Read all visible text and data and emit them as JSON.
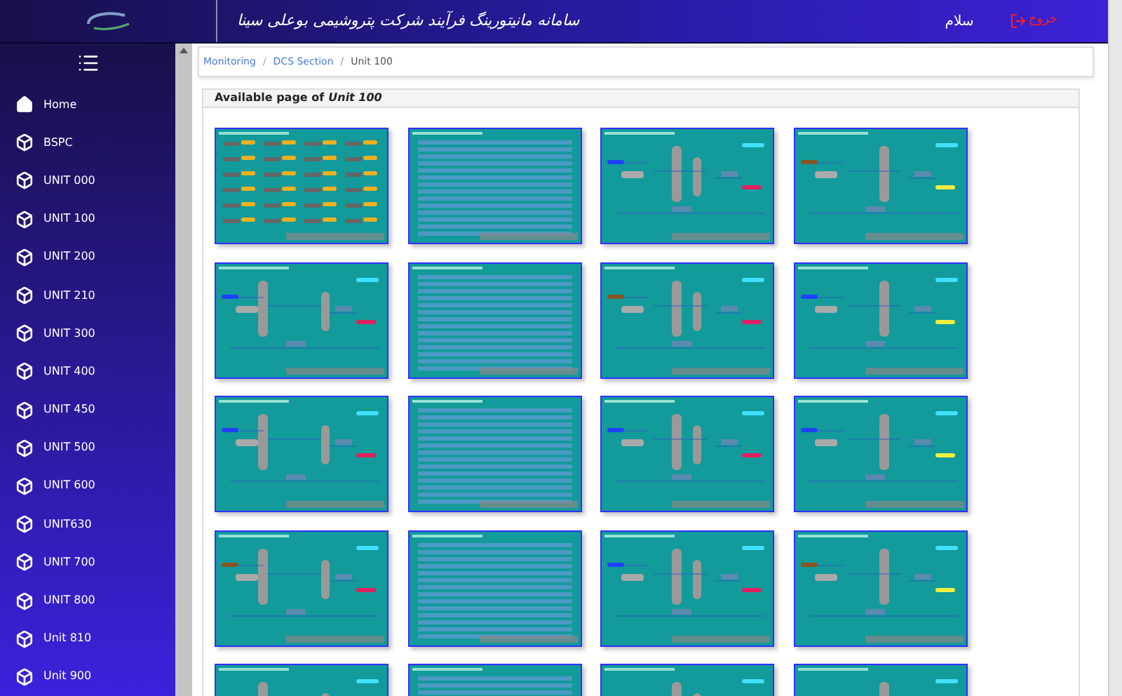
{
  "header": {
    "title": "سامانه مانیتورینگ فرآیند شرکت پتروشیمی بوعلی سینا",
    "greeting": "سلام",
    "logout": "خروج"
  },
  "sidebar": {
    "items": [
      {
        "label": "Home",
        "kind": "home"
      },
      {
        "label": "BSPC",
        "kind": "unit"
      },
      {
        "label": "UNIT 000",
        "kind": "unit"
      },
      {
        "label": "UNIT 100",
        "kind": "unit"
      },
      {
        "label": "UNIT 200",
        "kind": "unit"
      },
      {
        "label": "UNIT 210",
        "kind": "unit"
      },
      {
        "label": "UNIT 300",
        "kind": "unit"
      },
      {
        "label": "UNIT 400",
        "kind": "unit"
      },
      {
        "label": "UNIT 450",
        "kind": "unit"
      },
      {
        "label": "UNIT 500",
        "kind": "unit"
      },
      {
        "label": "UNIT 600",
        "kind": "unit"
      },
      {
        "label": "UNIT630",
        "kind": "unit"
      },
      {
        "label": "UNIT 700",
        "kind": "unit"
      },
      {
        "label": "UNIT 800",
        "kind": "unit"
      },
      {
        "label": "Unit 810",
        "kind": "unit"
      },
      {
        "label": "Unit 900",
        "kind": "unit"
      }
    ]
  },
  "breadcrumb": [
    {
      "label": "Monitoring",
      "link": true
    },
    {
      "separator": "/",
      "label": "DCS Section",
      "link": true
    },
    {
      "separator": "/",
      "label": "Unit 100",
      "link": false
    }
  ],
  "panel": {
    "title": "Available page of",
    "unit": "Unit 100"
  }
}
